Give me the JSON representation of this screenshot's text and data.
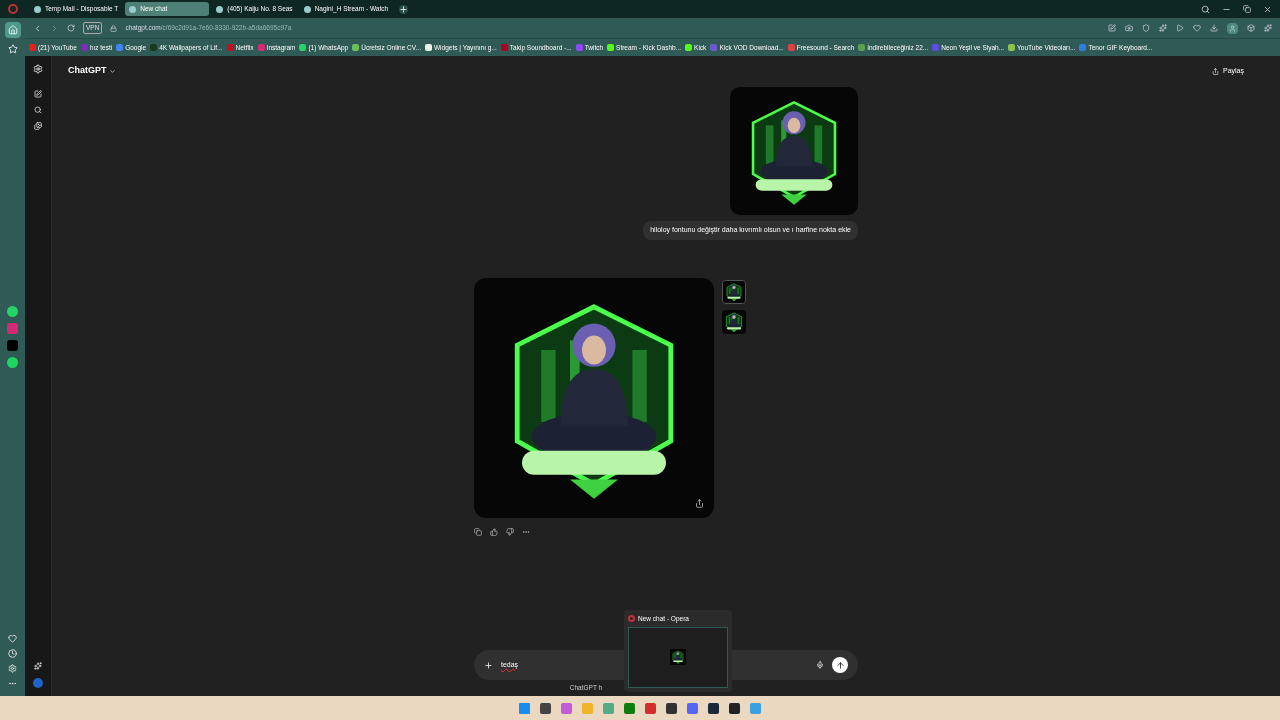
{
  "tabs": [
    {
      "title": "Temp Mail - Disposable T",
      "selected": false
    },
    {
      "title": "New chat",
      "selected": true
    },
    {
      "title": "(405) Kaiju No. 8 Seas",
      "selected": false
    },
    {
      "title": "Nagini_H Stream - Watch",
      "selected": false
    }
  ],
  "address": {
    "vpn": "VPN",
    "host": "chatgpt.com",
    "path": "/c/69c2d91a-7e60-8330-922b-a5da6695c97a"
  },
  "bookmarks": [
    {
      "label": "(21) YouTube",
      "color": "#e62117"
    },
    {
      "label": "hız testi",
      "color": "#7b2cbf"
    },
    {
      "label": "Google",
      "color": "#4285f4"
    },
    {
      "label": "4K Wallpapers of Lif...",
      "color": "#1b3a1b"
    },
    {
      "label": "Netflix",
      "color": "#c50f1f"
    },
    {
      "label": "Instagram",
      "color": "#d62976"
    },
    {
      "label": "(1) WhatsApp",
      "color": "#25d366"
    },
    {
      "label": "Ücretsiz Online CV...",
      "color": "#6bbf59"
    },
    {
      "label": "Widgets | Yayınını g...",
      "color": "#eeeeee"
    },
    {
      "label": "Takip Soundboard -...",
      "color": "#b00020"
    },
    {
      "label": "Twitch",
      "color": "#9146ff"
    },
    {
      "label": "Stream - Kick Dashb...",
      "color": "#53fc18"
    },
    {
      "label": "Kick",
      "color": "#53fc18"
    },
    {
      "label": "Kick VOD Download...",
      "color": "#6a5acd"
    },
    {
      "label": "Freesound - Search",
      "color": "#e04040"
    },
    {
      "label": "İndirebileceğiniz 22...",
      "color": "#5aa050"
    },
    {
      "label": "Neon Yeşil ve Siyah...",
      "color": "#5c4ee5"
    },
    {
      "label": "YouTube Videoları...",
      "color": "#8bc34a"
    },
    {
      "label": "Tenor GIF Keyboard...",
      "color": "#2f7de1"
    }
  ],
  "app": {
    "title": "ChatGPT",
    "share": "Paylaş"
  },
  "messages": [
    {
      "kind": "user_image"
    },
    {
      "kind": "user_text",
      "text": "hiloloy fontunu değiştir daha kıvrımlı olsun ve ı harfine nokta ekle"
    },
    {
      "kind": "assistant_image"
    }
  ],
  "composer": {
    "value": "tedaş"
  },
  "preview": {
    "title": "New chat - Opera"
  },
  "footer_note": "ChatGPT h"
}
